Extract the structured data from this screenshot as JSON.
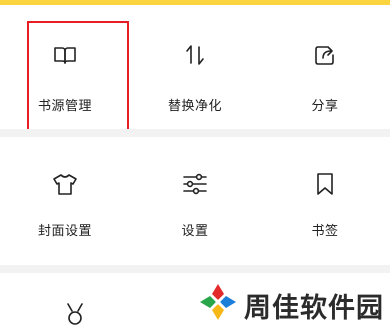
{
  "grid": {
    "row1": [
      {
        "label": "书源管理",
        "icon": "book-icon"
      },
      {
        "label": "替换净化",
        "icon": "swap-arrows-icon"
      },
      {
        "label": "分享",
        "icon": "share-icon"
      }
    ],
    "row2": [
      {
        "label": "封面设置",
        "icon": "tshirt-icon"
      },
      {
        "label": "设置",
        "icon": "sliders-icon"
      },
      {
        "label": "书签",
        "icon": "bookmark-icon"
      }
    ]
  },
  "watermark": {
    "text": "周佳软件园"
  },
  "colors": {
    "accent_bar": "#fbd43f",
    "highlight_border": "#e81e25",
    "divider": "#f2f2f2",
    "text": "#222222"
  }
}
